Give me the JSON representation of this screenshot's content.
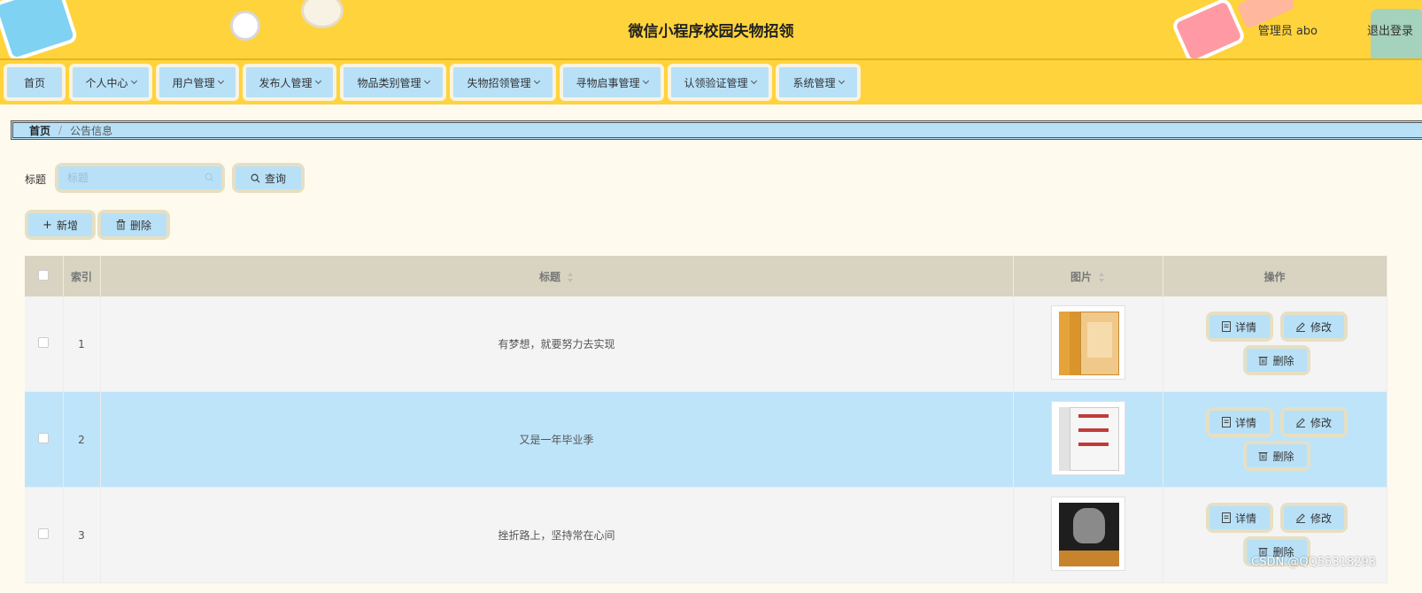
{
  "header": {
    "title": "微信小程序校园失物招领",
    "user": "管理员 abo",
    "logout": "退出登录"
  },
  "nav": [
    {
      "label": "首页",
      "has_dropdown": false
    },
    {
      "label": "个人中心",
      "has_dropdown": true
    },
    {
      "label": "用户管理",
      "has_dropdown": true
    },
    {
      "label": "发布人管理",
      "has_dropdown": true
    },
    {
      "label": "物品类别管理",
      "has_dropdown": true
    },
    {
      "label": "失物招领管理",
      "has_dropdown": true
    },
    {
      "label": "寻物启事管理",
      "has_dropdown": true
    },
    {
      "label": "认领验证管理",
      "has_dropdown": true
    },
    {
      "label": "系统管理",
      "has_dropdown": true
    }
  ],
  "breadcrumb": {
    "home": "首页",
    "separator": "/",
    "current": "公告信息"
  },
  "search": {
    "label": "标题",
    "placeholder": "标题",
    "value": "",
    "button": "查询"
  },
  "actions": {
    "add": "新增",
    "delete": "删除"
  },
  "table": {
    "columns": {
      "index": "索引",
      "title": "标题",
      "image": "图片",
      "ops": "操作"
    },
    "rows": [
      {
        "index": "1",
        "title": "有梦想，就要努力去实现",
        "image": "book-cover-yellow"
      },
      {
        "index": "2",
        "title": "又是一年毕业季",
        "image": "book-cover-white"
      },
      {
        "index": "3",
        "title": "挫折路上，坚持常在心间",
        "image": "book-cover-black"
      }
    ],
    "row_buttons": {
      "detail": "详情",
      "edit": "修改",
      "delete": "删除"
    }
  },
  "watermark": "CSDN @QQ55318293",
  "colors": {
    "header_bg": "#ffd33c",
    "button_bg": "#b8e1f8",
    "button_frame": "#e6dfc3",
    "table_head": "#d8d4c1",
    "row_highlight": "#bee4f9",
    "page_bg": "#fffaee"
  }
}
